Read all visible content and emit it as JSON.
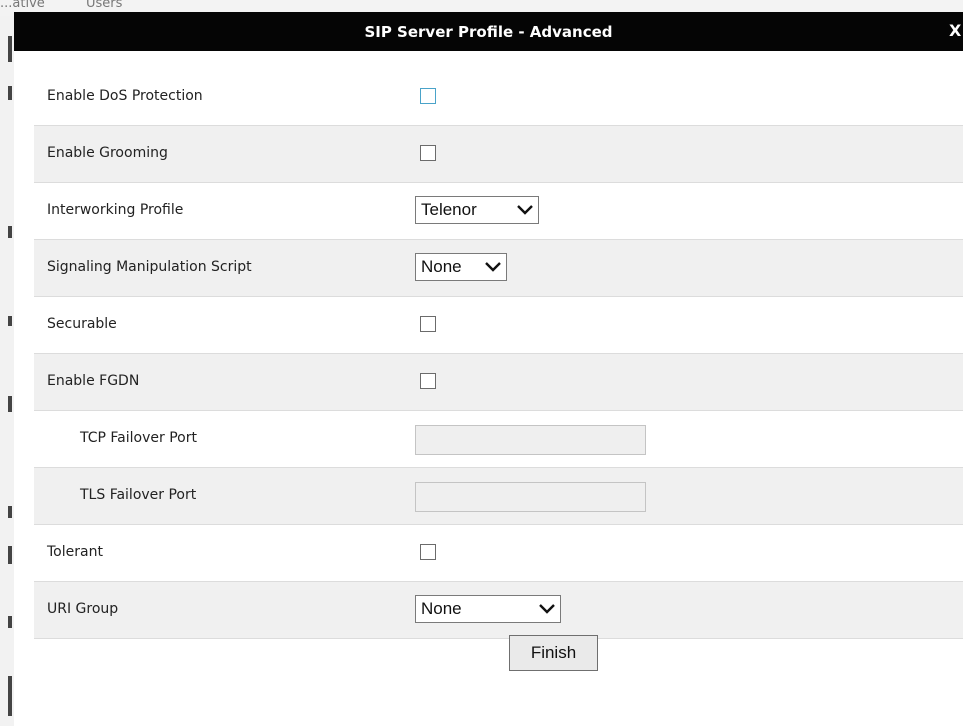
{
  "background": {
    "fragment_left": "...ative",
    "fragment_right": "Users"
  },
  "dialog": {
    "title": "SIP Server Profile - Advanced",
    "close_label": "X",
    "rows": [
      {
        "label": "Enable DoS Protection",
        "control": "checkbox",
        "checked": false
      },
      {
        "label": "Enable Grooming",
        "control": "checkbox",
        "checked": false
      },
      {
        "label": "Interworking Profile",
        "control": "select",
        "value": "Telenor"
      },
      {
        "label": "Signaling Manipulation Script",
        "control": "select",
        "value": "None"
      },
      {
        "label": "Securable",
        "control": "checkbox",
        "checked": false
      },
      {
        "label": "Enable FGDN",
        "control": "checkbox",
        "checked": false
      },
      {
        "label": "TCP Failover Port",
        "control": "text",
        "value": ""
      },
      {
        "label": "TLS Failover Port",
        "control": "text",
        "value": ""
      },
      {
        "label": "Tolerant",
        "control": "checkbox",
        "checked": false
      },
      {
        "label": "URI Group",
        "control": "select",
        "value": "None"
      }
    ],
    "finish_label": "Finish"
  },
  "colors": {
    "titlebar": "#050505",
    "row_alt": "#f0f0f0",
    "focus_border": "#4aa3c9"
  },
  "icons": {
    "select_arrow": "chevron-down-icon"
  }
}
